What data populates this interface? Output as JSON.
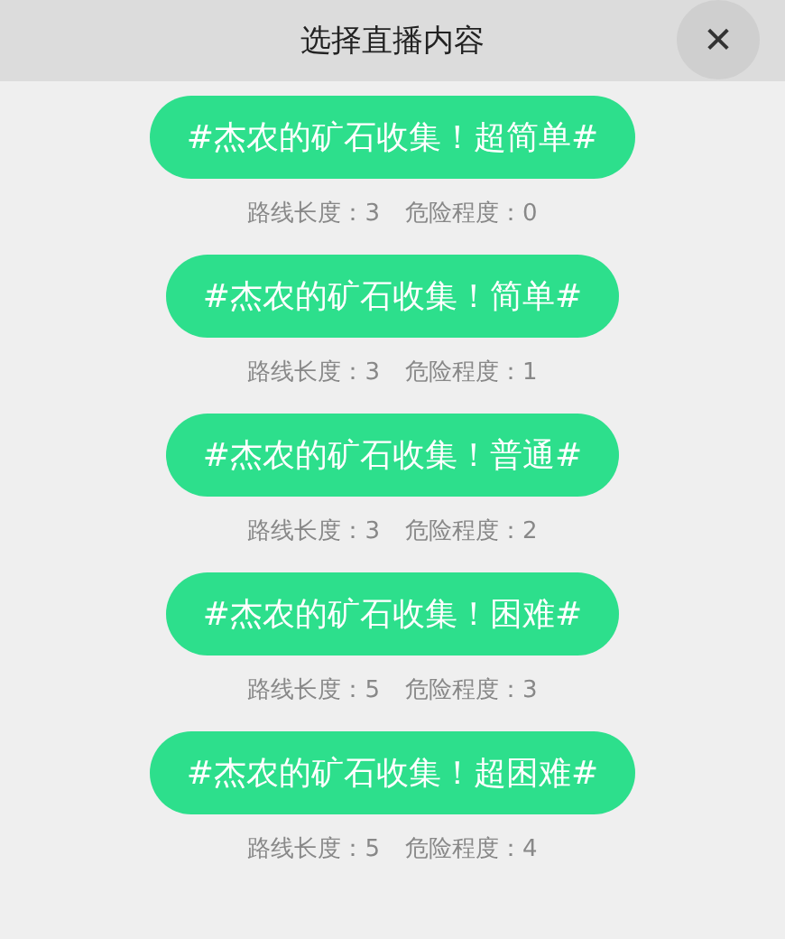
{
  "header": {
    "title": "选择直播内容",
    "close": "✕"
  },
  "options": [
    {
      "label": "#杰农的矿石收集！超简单#",
      "route": "路线长度：3",
      "danger": "危险程度：0"
    },
    {
      "label": "#杰农的矿石收集！简单#",
      "route": "路线长度：3",
      "danger": "危险程度：1"
    },
    {
      "label": "#杰农的矿石收集！普通#",
      "route": "路线长度：3",
      "danger": "危险程度：2"
    },
    {
      "label": "#杰农的矿石收集！困难#",
      "route": "路线长度：5",
      "danger": "危险程度：3"
    },
    {
      "label": "#杰农的矿石收集！超困难#",
      "route": "路线长度：5",
      "danger": "危险程度：4"
    }
  ]
}
